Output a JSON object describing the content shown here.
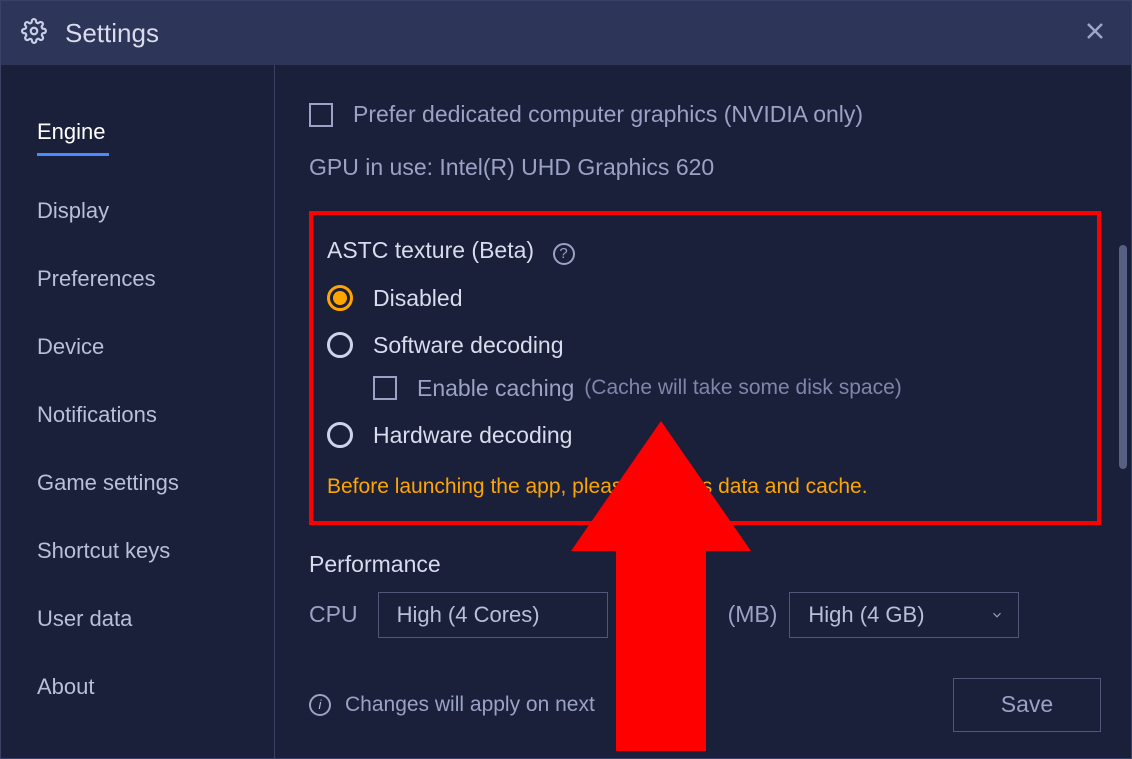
{
  "titlebar": {
    "title": "Settings"
  },
  "sidebar": {
    "items": [
      {
        "label": "Engine",
        "active": true
      },
      {
        "label": "Display",
        "active": false
      },
      {
        "label": "Preferences",
        "active": false
      },
      {
        "label": "Device",
        "active": false
      },
      {
        "label": "Notifications",
        "active": false
      },
      {
        "label": "Game settings",
        "active": false
      },
      {
        "label": "Shortcut keys",
        "active": false
      },
      {
        "label": "User data",
        "active": false
      },
      {
        "label": "About",
        "active": false
      }
    ]
  },
  "gpu_section": {
    "prefer_dedicated_label": "Prefer dedicated computer graphics (NVIDIA only)",
    "gpu_in_use": "GPU in use: Intel(R) UHD Graphics 620"
  },
  "astc": {
    "title": "ASTC texture (Beta)",
    "options": {
      "disabled": "Disabled",
      "software": "Software decoding",
      "hardware": "Hardware decoding"
    },
    "enable_caching_label": "Enable caching",
    "enable_caching_hint": "(Cache will take some disk space)",
    "warning": "Before launching the app, please clear its data and cache."
  },
  "performance": {
    "title": "Performance",
    "cpu_label": "CPU",
    "cpu_value": "High (4 Cores)",
    "memory_label": "(MB)",
    "memory_value": "High (4 GB)"
  },
  "footer": {
    "info_text": "Changes will apply on next",
    "save_label": "Save"
  }
}
